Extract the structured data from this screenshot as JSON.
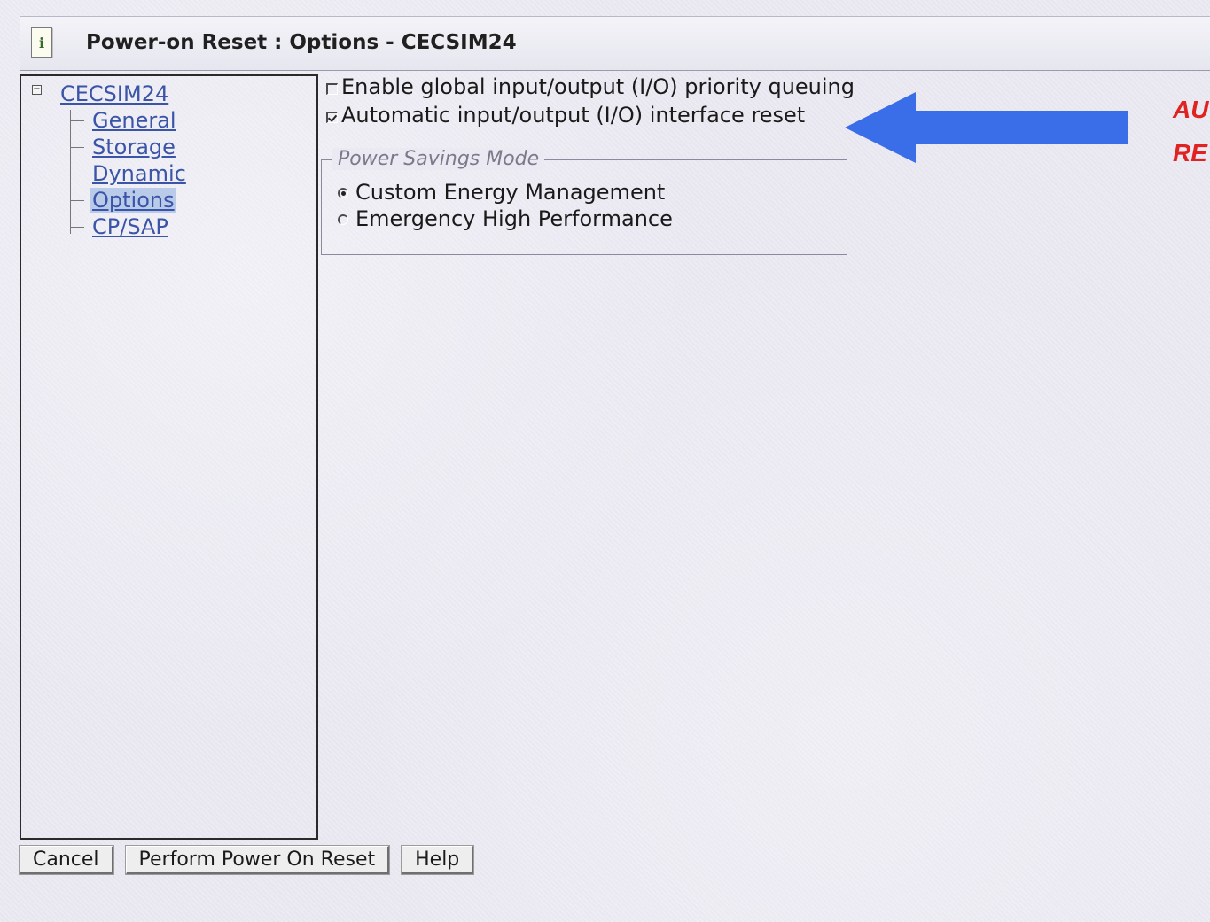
{
  "window": {
    "title": "Power-on Reset : Options - CECSIM24",
    "icon": "info-icon",
    "icon_glyph": "i"
  },
  "tree": {
    "root_label": "CECSIM24",
    "toggle_glyph": "−",
    "items": [
      {
        "label": "General",
        "selected": false
      },
      {
        "label": "Storage",
        "selected": false
      },
      {
        "label": "Dynamic",
        "selected": false
      },
      {
        "label": "Options",
        "selected": true
      },
      {
        "label": "CP/SAP",
        "selected": false
      }
    ]
  },
  "options": {
    "checkboxes": [
      {
        "label": "Enable global input/output (I/O) priority queuing",
        "checked": false
      },
      {
        "label": "Automatic input/output (I/O) interface reset",
        "checked": true
      }
    ],
    "power_savings": {
      "legend": "Power Savings Mode",
      "radios": [
        {
          "label": "Custom Energy Management",
          "selected": true
        },
        {
          "label": "Emergency High Performance",
          "selected": false
        }
      ]
    }
  },
  "annotation": {
    "line1": "AU",
    "line2": "RE",
    "color": "#e02222",
    "arrow_color": "#3a6de8"
  },
  "buttons": {
    "cancel": "Cancel",
    "perform": "Perform Power On Reset",
    "help": "Help"
  }
}
